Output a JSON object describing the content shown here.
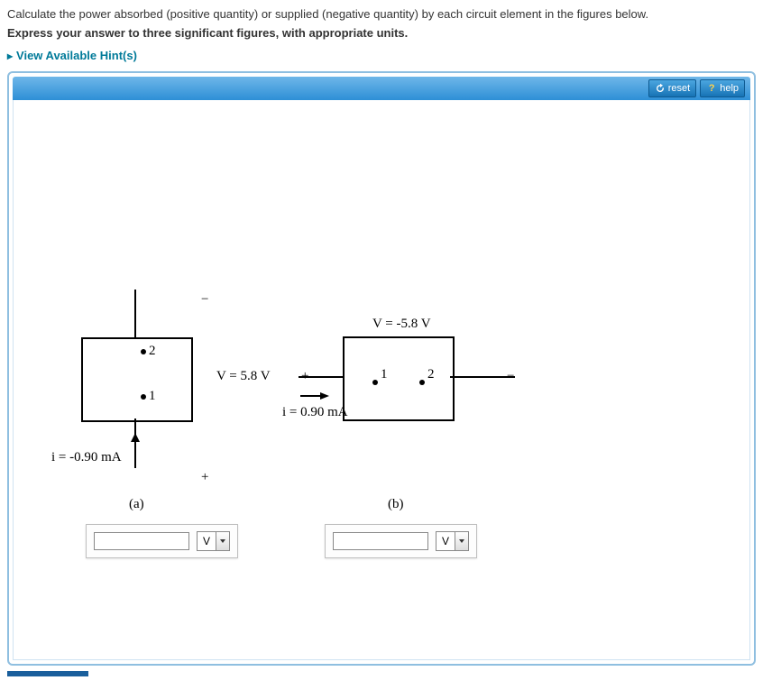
{
  "question": "Calculate the power absorbed (positive quantity) or supplied (negative quantity) by each circuit element in the figures below.",
  "instruction": "Express your answer to three significant figures, with appropriate units.",
  "hints_label": "View Available Hint(s)",
  "toolbar": {
    "reset": "reset",
    "help": "help"
  },
  "fig_a": {
    "voltage": "V = 5.8 V",
    "current": "i = -0.90 mA",
    "minus": "−",
    "plus": "+",
    "node2": "2",
    "node1": "1",
    "label": "(a)"
  },
  "fig_b": {
    "voltage": "V = -5.8 V",
    "current": "i = 0.90 mA",
    "plus": "+",
    "minus": "−",
    "node1": "1",
    "node2": "2",
    "label": "(b)"
  },
  "answer": {
    "a_value": "",
    "b_value": "",
    "unit": "V"
  }
}
